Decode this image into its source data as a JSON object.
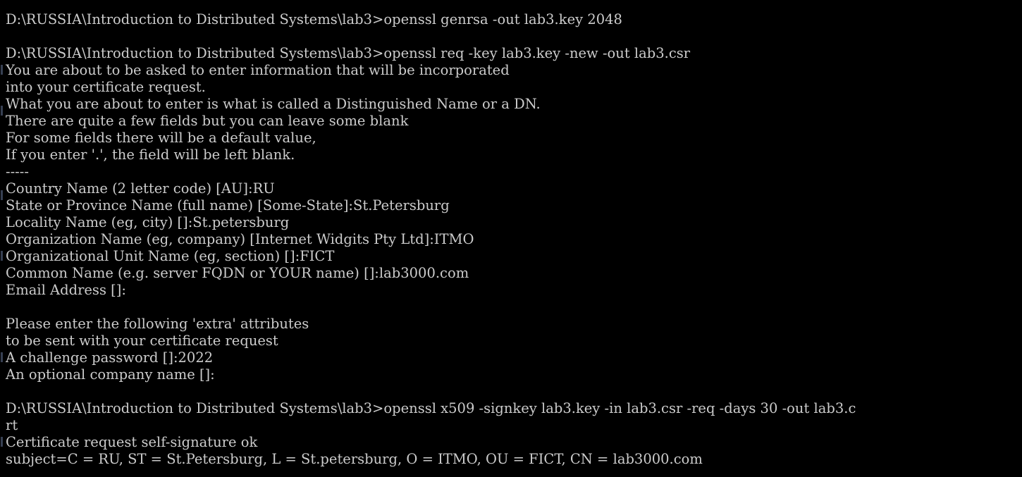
{
  "terminal": {
    "lines": [
      "D:\\RUSSIA\\Introduction to Distributed Systems\\lab3>openssl genrsa -out lab3.key 2048",
      "",
      "D:\\RUSSIA\\Introduction to Distributed Systems\\lab3>openssl req -key lab3.key -new -out lab3.csr",
      "You are about to be asked to enter information that will be incorporated",
      "into your certificate request.",
      "What you are about to enter is what is called a Distinguished Name or a DN.",
      "There are quite a few fields but you can leave some blank",
      "For some fields there will be a default value,",
      "If you enter '.', the field will be left blank.",
      "-----",
      "Country Name (2 letter code) [AU]:RU",
      "State or Province Name (full name) [Some-State]:St.Petersburg",
      "Locality Name (eg, city) []:St.petersburg",
      "Organization Name (eg, company) [Internet Widgits Pty Ltd]:ITMO",
      "Organizational Unit Name (eg, section) []:FICT",
      "Common Name (e.g. server FQDN or YOUR name) []:lab3000.com",
      "Email Address []:",
      "",
      "Please enter the following 'extra' attributes",
      "to be sent with your certificate request",
      "A challenge password []:2022",
      "An optional company name []:",
      "",
      "D:\\RUSSIA\\Introduction to Distributed Systems\\lab3>openssl x509 -signkey lab3.key -in lab3.csr -req -days 30 -out lab3.c",
      "rt",
      "Certificate request self-signature ok",
      "subject=C = RU, ST = St.Petersburg, L = St.petersburg, O = ITMO, OU = FICT, CN = lab3000.com"
    ]
  },
  "colors": {
    "background": "#000000",
    "text": "#cccccc"
  }
}
